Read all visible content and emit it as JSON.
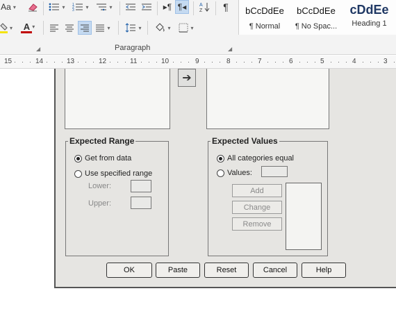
{
  "ribbon": {
    "font": {
      "size_label": "Aa",
      "clear_format_icon": "eraser-icon",
      "font_color_label": "A",
      "highlight_color": "#f4e30f",
      "font_color": "#c00000"
    },
    "paragraph": {
      "label": "Paragraph",
      "show_marks_symbol": "¶",
      "sort_label": "A Z",
      "rtl_symbol": "¶◂",
      "ltr_symbol": "▸¶"
    },
    "styles": [
      {
        "preview": "bCcDdEe",
        "name": "¶ Normal"
      },
      {
        "preview": "bCcDdEe",
        "name": "¶ No Spac..."
      },
      {
        "preview": "cDdEe",
        "name": "Heading 1"
      }
    ]
  },
  "ruler": {
    "numbers": [
      "15",
      "14",
      "13",
      "12",
      "11",
      "10",
      "9",
      "8",
      "7",
      "6",
      "5",
      "4",
      "3"
    ]
  },
  "dialog": {
    "expected_range": {
      "title": "Expected Range",
      "options": [
        "Get from data",
        "Use specified range"
      ],
      "selected": "Get from data",
      "lower_label": "Lower:",
      "upper_label": "Upper:",
      "lower_value": "",
      "upper_value": ""
    },
    "expected_values": {
      "title": "Expected Values",
      "options": [
        "All categories equal",
        "Values:"
      ],
      "selected": "All categories equal",
      "values_input": "",
      "add_label": "Add",
      "change_label": "Change",
      "remove_label": "Remove"
    },
    "buttons": {
      "ok": "OK",
      "paste": "Paste",
      "reset": "Reset",
      "cancel": "Cancel",
      "help": "Help"
    }
  }
}
